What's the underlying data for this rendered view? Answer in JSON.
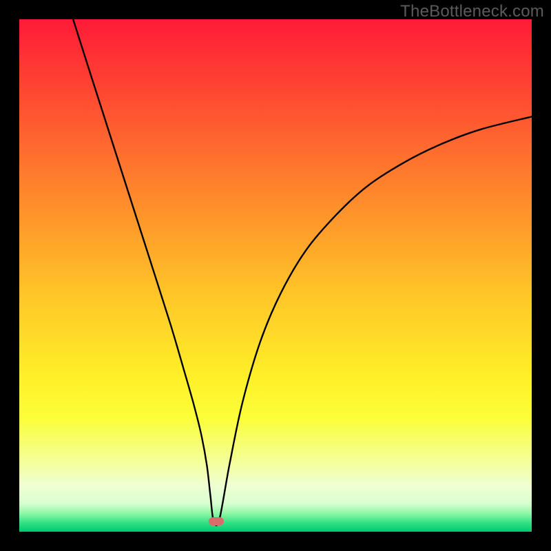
{
  "watermark": "TheBottleneck.com",
  "colors": {
    "frame": "#000000",
    "curve": "#000000",
    "marker": "#d96d6c",
    "gradient_stops": [
      {
        "offset": 0.0,
        "color": "#ff1b36"
      },
      {
        "offset": 0.1,
        "color": "#ff3a33"
      },
      {
        "offset": 0.25,
        "color": "#ff6a2f"
      },
      {
        "offset": 0.4,
        "color": "#ff9a2a"
      },
      {
        "offset": 0.55,
        "color": "#ffc928"
      },
      {
        "offset": 0.7,
        "color": "#fff028"
      },
      {
        "offset": 0.78,
        "color": "#fbff3a"
      },
      {
        "offset": 0.86,
        "color": "#f4ff96"
      },
      {
        "offset": 0.91,
        "color": "#efffd2"
      },
      {
        "offset": 0.945,
        "color": "#d8ffd0"
      },
      {
        "offset": 0.965,
        "color": "#8bf7a4"
      },
      {
        "offset": 0.982,
        "color": "#34e285"
      },
      {
        "offset": 1.0,
        "color": "#00c86f"
      }
    ]
  },
  "chart_data": {
    "type": "line",
    "title": "",
    "xlabel": "",
    "ylabel": "",
    "xlim": [
      0,
      100
    ],
    "ylim": [
      0,
      100
    ],
    "series": [
      {
        "name": "bottleneck-curve",
        "x": [
          10.5,
          14,
          18,
          22,
          26,
          29.5,
          32,
          34,
          35.5,
          36.6,
          37.3,
          37.9,
          39.0,
          41.0,
          43.5,
          47,
          51,
          56,
          62,
          68,
          75,
          82,
          90,
          100
        ],
        "values": [
          100,
          89,
          76.5,
          64,
          51.5,
          40.5,
          32,
          25,
          19,
          13,
          7,
          2.2,
          2.2,
          13,
          25,
          37,
          46.5,
          55,
          62,
          67.5,
          72,
          75.5,
          78.5,
          81
        ]
      }
    ],
    "annotations": [
      {
        "name": "optimum-marker",
        "x": 38.4,
        "y": 2.0
      }
    ]
  }
}
